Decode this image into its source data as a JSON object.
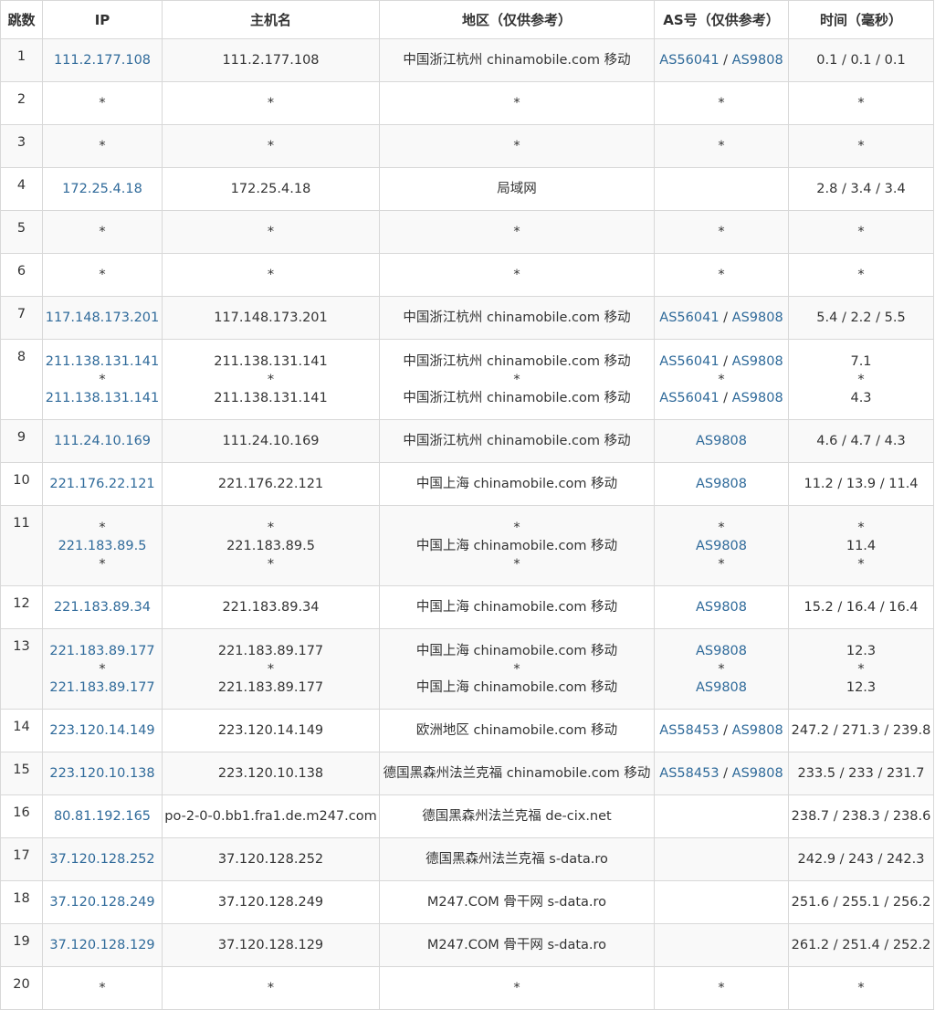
{
  "columns": [
    "跳数",
    "IP",
    "主机名",
    "地区（仅供参考）",
    "AS号（仅供参考）",
    "时间（毫秒）"
  ],
  "rows": [
    {
      "hop": "1",
      "ip": [
        "111.2.177.108"
      ],
      "host": [
        "111.2.177.108"
      ],
      "geo": [
        "中国浙江杭州 chinamobile.com 移动"
      ],
      "as": [
        [
          "AS56041",
          "AS9808"
        ]
      ],
      "time": [
        "0.1 / 0.1 / 0.1"
      ]
    },
    {
      "hop": "2",
      "ip": [
        "*"
      ],
      "host": [
        "*"
      ],
      "geo": [
        "*"
      ],
      "as": [
        [
          "*"
        ]
      ],
      "time": [
        "*"
      ]
    },
    {
      "hop": "3",
      "ip": [
        "*"
      ],
      "host": [
        "*"
      ],
      "geo": [
        "*"
      ],
      "as": [
        [
          "*"
        ]
      ],
      "time": [
        "*"
      ]
    },
    {
      "hop": "4",
      "ip": [
        "172.25.4.18"
      ],
      "host": [
        "172.25.4.18"
      ],
      "geo": [
        "局域网"
      ],
      "as": [
        []
      ],
      "time": [
        "2.8 / 3.4 / 3.4"
      ]
    },
    {
      "hop": "5",
      "ip": [
        "*"
      ],
      "host": [
        "*"
      ],
      "geo": [
        "*"
      ],
      "as": [
        [
          "*"
        ]
      ],
      "time": [
        "*"
      ]
    },
    {
      "hop": "6",
      "ip": [
        "*"
      ],
      "host": [
        "*"
      ],
      "geo": [
        "*"
      ],
      "as": [
        [
          "*"
        ]
      ],
      "time": [
        "*"
      ]
    },
    {
      "hop": "7",
      "ip": [
        "117.148.173.201"
      ],
      "host": [
        "117.148.173.201"
      ],
      "geo": [
        "中国浙江杭州 chinamobile.com 移动"
      ],
      "as": [
        [
          "AS56041",
          "AS9808"
        ]
      ],
      "time": [
        "5.4 / 2.2 / 5.5"
      ]
    },
    {
      "hop": "8",
      "ip": [
        "211.138.131.141",
        "*",
        "211.138.131.141"
      ],
      "host": [
        "211.138.131.141",
        "*",
        "211.138.131.141"
      ],
      "geo": [
        "中国浙江杭州 chinamobile.com 移动",
        "*",
        "中国浙江杭州 chinamobile.com 移动"
      ],
      "as": [
        [
          "AS56041",
          "AS9808"
        ],
        [
          "*"
        ],
        [
          "AS56041",
          "AS9808"
        ]
      ],
      "time": [
        "7.1",
        "*",
        "4.3"
      ]
    },
    {
      "hop": "9",
      "ip": [
        "111.24.10.169"
      ],
      "host": [
        "111.24.10.169"
      ],
      "geo": [
        "中国浙江杭州 chinamobile.com 移动"
      ],
      "as": [
        [
          "AS9808"
        ]
      ],
      "time": [
        "4.6 / 4.7 / 4.3"
      ]
    },
    {
      "hop": "10",
      "ip": [
        "221.176.22.121"
      ],
      "host": [
        "221.176.22.121"
      ],
      "geo": [
        "中国上海 chinamobile.com 移动"
      ],
      "as": [
        [
          "AS9808"
        ]
      ],
      "time": [
        "11.2 / 13.9 / 11.4"
      ]
    },
    {
      "hop": "11",
      "ip": [
        "*",
        "221.183.89.5",
        "*"
      ],
      "host": [
        "*",
        "221.183.89.5",
        "*"
      ],
      "geo": [
        "*",
        "中国上海 chinamobile.com 移动",
        "*"
      ],
      "as": [
        [
          "*"
        ],
        [
          "AS9808"
        ],
        [
          "*"
        ]
      ],
      "time": [
        "*",
        "11.4",
        "*"
      ]
    },
    {
      "hop": "12",
      "ip": [
        "221.183.89.34"
      ],
      "host": [
        "221.183.89.34"
      ],
      "geo": [
        "中国上海 chinamobile.com 移动"
      ],
      "as": [
        [
          "AS9808"
        ]
      ],
      "time": [
        "15.2 / 16.4 / 16.4"
      ]
    },
    {
      "hop": "13",
      "ip": [
        "221.183.89.177",
        "*",
        "221.183.89.177"
      ],
      "host": [
        "221.183.89.177",
        "*",
        "221.183.89.177"
      ],
      "geo": [
        "中国上海 chinamobile.com 移动",
        "*",
        "中国上海 chinamobile.com 移动"
      ],
      "as": [
        [
          "AS9808"
        ],
        [
          "*"
        ],
        [
          "AS9808"
        ]
      ],
      "time": [
        "12.3",
        "*",
        "12.3"
      ]
    },
    {
      "hop": "14",
      "ip": [
        "223.120.14.149"
      ],
      "host": [
        "223.120.14.149"
      ],
      "geo": [
        "欧洲地区 chinamobile.com 移动"
      ],
      "as": [
        [
          "AS58453",
          "AS9808"
        ]
      ],
      "time": [
        "247.2 / 271.3 / 239.8"
      ]
    },
    {
      "hop": "15",
      "ip": [
        "223.120.10.138"
      ],
      "host": [
        "223.120.10.138"
      ],
      "geo": [
        "德国黑森州法兰克福 chinamobile.com 移动"
      ],
      "as": [
        [
          "AS58453",
          "AS9808"
        ]
      ],
      "time": [
        "233.5 / 233 / 231.7"
      ]
    },
    {
      "hop": "16",
      "ip": [
        "80.81.192.165"
      ],
      "host": [
        "po-2-0-0.bb1.fra1.de.m247.com"
      ],
      "geo": [
        "德国黑森州法兰克福 de-cix.net"
      ],
      "as": [
        []
      ],
      "time": [
        "238.7 / 238.3 / 238.6"
      ]
    },
    {
      "hop": "17",
      "ip": [
        "37.120.128.252"
      ],
      "host": [
        "37.120.128.252"
      ],
      "geo": [
        "德国黑森州法兰克福 s-data.ro"
      ],
      "as": [
        []
      ],
      "time": [
        "242.9 / 243 / 242.3"
      ]
    },
    {
      "hop": "18",
      "ip": [
        "37.120.128.249"
      ],
      "host": [
        "37.120.128.249"
      ],
      "geo": [
        "M247.COM 骨干网 s-data.ro"
      ],
      "as": [
        []
      ],
      "time": [
        "251.6 / 255.1 / 256.2"
      ]
    },
    {
      "hop": "19",
      "ip": [
        "37.120.128.129"
      ],
      "host": [
        "37.120.128.129"
      ],
      "geo": [
        "M247.COM 骨干网 s-data.ro"
      ],
      "as": [
        []
      ],
      "time": [
        "261.2 / 251.4 / 252.2"
      ]
    },
    {
      "hop": "20",
      "ip": [
        "*"
      ],
      "host": [
        "*"
      ],
      "geo": [
        "*"
      ],
      "as": [
        [
          "*"
        ]
      ],
      "time": [
        "*"
      ]
    }
  ],
  "colors": {
    "link": "#2f6a9a",
    "border": "#d8d8d8",
    "stripe": "#f9f9f9",
    "text": "#333333"
  }
}
